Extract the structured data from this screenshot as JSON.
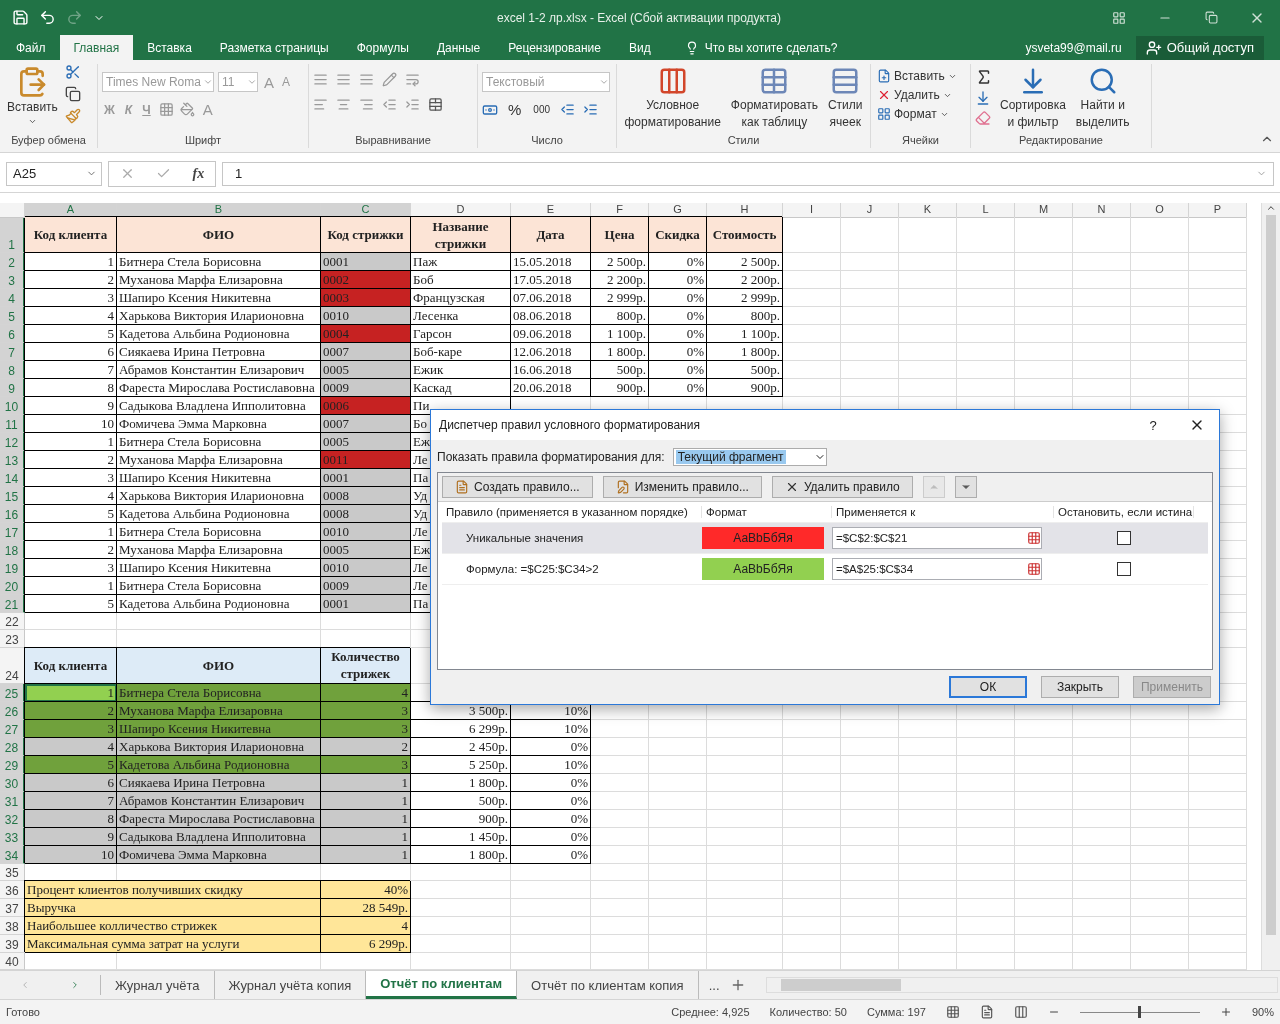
{
  "title_bar": {
    "title": "excel 1-2 лр.xlsx - Excel (Сбой активации продукта)"
  },
  "ribbon_tabs": [
    {
      "label": "Файл",
      "selected": false
    },
    {
      "label": "Главная",
      "selected": true
    },
    {
      "label": "Вставка",
      "selected": false
    },
    {
      "label": "Разметка страницы",
      "selected": false
    },
    {
      "label": "Формулы",
      "selected": false
    },
    {
      "label": "Данные",
      "selected": false
    },
    {
      "label": "Рецензирование",
      "selected": false
    },
    {
      "label": "Вид",
      "selected": false
    }
  ],
  "tell_me": "Что вы хотите сделать?",
  "account": {
    "user": "ysveta99@mail.ru",
    "share": "Общий доступ"
  },
  "ribbon": {
    "clipboard": {
      "paste": "Вставить",
      "label": "Буфер обмена"
    },
    "font": {
      "name": "Times New Roma",
      "size": "11",
      "grow": "A",
      "shrink": "A",
      "bold": "Ж",
      "italic": "К",
      "underline": "Ч",
      "font_color_button": "A",
      "label": "Шрифт"
    },
    "alignment": {
      "label": "Выравнивание"
    },
    "number": {
      "format": "Текстовый",
      "percent": "%",
      "thousands": "000",
      "label": "Число"
    },
    "styles": {
      "buttons": [
        [
          "Условное",
          "форматирование"
        ],
        [
          "Форматировать",
          "как таблицу"
        ],
        [
          "Стили",
          "ячеек"
        ]
      ],
      "label": "Стили"
    },
    "cells": {
      "buttons": [
        "Вставить",
        "Удалить",
        "Формат"
      ],
      "label": "Ячейки"
    },
    "editing": {
      "buttons": [
        [
          "Сортировка",
          "и фильтр"
        ],
        [
          "Найти и",
          "выделить"
        ]
      ],
      "label": "Редактирование"
    }
  },
  "formula_bar": {
    "name_box": "A25",
    "fx": "fx",
    "value": "1"
  },
  "columns": [
    {
      "label": "A",
      "selected": true
    },
    {
      "label": "B",
      "selected": true
    },
    {
      "label": "C",
      "selected": true
    },
    {
      "label": "D",
      "selected": false
    },
    {
      "label": "E",
      "selected": false
    },
    {
      "label": "F",
      "selected": false
    },
    {
      "label": "G",
      "selected": false
    },
    {
      "label": "H",
      "selected": false
    },
    {
      "label": "I",
      "selected": false
    },
    {
      "label": "J",
      "selected": false
    },
    {
      "label": "K",
      "selected": false
    },
    {
      "label": "L",
      "selected": false
    },
    {
      "label": "M",
      "selected": false
    },
    {
      "label": "N",
      "selected": false
    },
    {
      "label": "O",
      "selected": false
    },
    {
      "label": "P",
      "selected": false
    }
  ],
  "rows": [
    {
      "num": "1",
      "selected": true,
      "cells": [
        {
          "text": "Код клиента",
          "kind": "head"
        },
        {
          "text": "ФИО",
          "kind": "head"
        },
        {
          "text": "Код стрижки",
          "kind": "head"
        },
        {
          "text": "Название стрижки",
          "kind": "head"
        },
        {
          "text": "Дата",
          "kind": "head"
        },
        {
          "text": "Цена",
          "kind": "head"
        },
        {
          "text": "Скидка",
          "kind": "head"
        },
        {
          "text": "Стоимость",
          "kind": "head"
        }
      ]
    },
    {
      "num": "2",
      "selected": true,
      "cells": [
        {
          "text": "1",
          "kind": "num"
        },
        {
          "text": "Битнера Стела Борисовна",
          "kind": "text"
        },
        {
          "text": "0001",
          "kind": "code_unique"
        },
        {
          "text": "Паж",
          "kind": "text"
        },
        {
          "text": "15.05.2018",
          "kind": "text"
        },
        {
          "text": "2 500р.",
          "kind": "num"
        },
        {
          "text": "0%",
          "kind": "num"
        },
        {
          "text": "2 500р.",
          "kind": "num"
        }
      ]
    },
    {
      "num": "3",
      "selected": true,
      "cells": [
        {
          "text": "2",
          "kind": "num"
        },
        {
          "text": "Муханова Марфа Елизаровна",
          "kind": "text"
        },
        {
          "text": "0002",
          "kind": "code_dup"
        },
        {
          "text": "Боб",
          "kind": "text"
        },
        {
          "text": "17.05.2018",
          "kind": "text"
        },
        {
          "text": "2 200р.",
          "kind": "num"
        },
        {
          "text": "0%",
          "kind": "num"
        },
        {
          "text": "2 200р.",
          "kind": "num"
        }
      ]
    },
    {
      "num": "4",
      "selected": true,
      "cells": [
        {
          "text": "3",
          "kind": "num"
        },
        {
          "text": "Шапиро Ксения Никитевна",
          "kind": "text"
        },
        {
          "text": "0003",
          "kind": "code_dup"
        },
        {
          "text": "Французская",
          "kind": "text"
        },
        {
          "text": "07.06.2018",
          "kind": "text"
        },
        {
          "text": "2 999р.",
          "kind": "num"
        },
        {
          "text": "0%",
          "kind": "num"
        },
        {
          "text": "2 999р.",
          "kind": "num"
        }
      ]
    },
    {
      "num": "5",
      "selected": true,
      "cells": [
        {
          "text": "4",
          "kind": "num"
        },
        {
          "text": "Харькова Виктория Иларионовна",
          "kind": "text"
        },
        {
          "text": "0010",
          "kind": "code_unique"
        },
        {
          "text": "Лесенка",
          "kind": "text"
        },
        {
          "text": "08.06.2018",
          "kind": "text"
        },
        {
          "text": "800р.",
          "kind": "num"
        },
        {
          "text": "0%",
          "kind": "num"
        },
        {
          "text": "800р.",
          "kind": "num"
        }
      ]
    },
    {
      "num": "6",
      "selected": true,
      "cells": [
        {
          "text": "5",
          "kind": "num"
        },
        {
          "text": "Кадетова Альбина Родионовна",
          "kind": "text"
        },
        {
          "text": "0004",
          "kind": "code_dup"
        },
        {
          "text": "Гарсон",
          "kind": "text"
        },
        {
          "text": "09.06.2018",
          "kind": "text"
        },
        {
          "text": "1 100р.",
          "kind": "num"
        },
        {
          "text": "0%",
          "kind": "num"
        },
        {
          "text": "1 100р.",
          "kind": "num"
        }
      ]
    },
    {
      "num": "7",
      "selected": true,
      "cells": [
        {
          "text": "6",
          "kind": "num"
        },
        {
          "text": "Сиякаева Ирина Петровна",
          "kind": "text"
        },
        {
          "text": "0007",
          "kind": "code_unique"
        },
        {
          "text": "Боб-каре",
          "kind": "text"
        },
        {
          "text": "12.06.2018",
          "kind": "text"
        },
        {
          "text": "1 800р.",
          "kind": "num"
        },
        {
          "text": "0%",
          "kind": "num"
        },
        {
          "text": "1 800р.",
          "kind": "num"
        }
      ]
    },
    {
      "num": "8",
      "selected": true,
      "cells": [
        {
          "text": "7",
          "kind": "num"
        },
        {
          "text": "Абрамов Константин Елизарович",
          "kind": "text"
        },
        {
          "text": "0005",
          "kind": "code_unique"
        },
        {
          "text": "Ежик",
          "kind": "text"
        },
        {
          "text": "16.06.2018",
          "kind": "text"
        },
        {
          "text": "500р.",
          "kind": "num"
        },
        {
          "text": "0%",
          "kind": "num"
        },
        {
          "text": "500р.",
          "kind": "num"
        }
      ]
    },
    {
      "num": "9",
      "selected": true,
      "cells": [
        {
          "text": "8",
          "kind": "num"
        },
        {
          "text": "Фареста Мирослава Ростиславовна",
          "kind": "text"
        },
        {
          "text": "0009",
          "kind": "code_unique"
        },
        {
          "text": "Каскад",
          "kind": "text"
        },
        {
          "text": "20.06.2018",
          "kind": "text"
        },
        {
          "text": "900р.",
          "kind": "num"
        },
        {
          "text": "0%",
          "kind": "num"
        },
        {
          "text": "900р.",
          "kind": "num"
        }
      ]
    },
    {
      "num": "10",
      "selected": true,
      "cells": [
        {
          "text": "9",
          "kind": "num"
        },
        {
          "text": "Садыкова Владлена Ипполитовна",
          "kind": "text"
        },
        {
          "text": "0006",
          "kind": "code_dup"
        },
        {
          "text": "Пи",
          "kind": "text"
        }
      ]
    },
    {
      "num": "11",
      "selected": true,
      "cells": [
        {
          "text": "10",
          "kind": "num"
        },
        {
          "text": "Фомичева Эмма Марковна",
          "kind": "text"
        },
        {
          "text": "0007",
          "kind": "code_unique"
        },
        {
          "text": "Бо",
          "kind": "text"
        }
      ]
    },
    {
      "num": "12",
      "selected": true,
      "cells": [
        {
          "text": "1",
          "kind": "num"
        },
        {
          "text": "Битнера Стела Борисовна",
          "kind": "text"
        },
        {
          "text": "0005",
          "kind": "code_unique"
        },
        {
          "text": "Еж",
          "kind": "text"
        }
      ]
    },
    {
      "num": "13",
      "selected": true,
      "cells": [
        {
          "text": "2",
          "kind": "num"
        },
        {
          "text": "Муханова Марфа Елизаровна",
          "kind": "text"
        },
        {
          "text": "0011",
          "kind": "code_dup"
        },
        {
          "text": "Ле",
          "kind": "text"
        }
      ]
    },
    {
      "num": "14",
      "selected": true,
      "cells": [
        {
          "text": "3",
          "kind": "num"
        },
        {
          "text": "Шапиро Ксения Никитевна",
          "kind": "text"
        },
        {
          "text": "0001",
          "kind": "code_unique"
        },
        {
          "text": "Па",
          "kind": "text"
        }
      ]
    },
    {
      "num": "15",
      "selected": true,
      "cells": [
        {
          "text": "4",
          "kind": "num"
        },
        {
          "text": "Харькова Виктория Иларионовна",
          "kind": "text"
        },
        {
          "text": "0008",
          "kind": "code_unique"
        },
        {
          "text": "Уд",
          "kind": "text"
        }
      ]
    },
    {
      "num": "16",
      "selected": true,
      "cells": [
        {
          "text": "5",
          "kind": "num"
        },
        {
          "text": "Кадетова Альбина Родионовна",
          "kind": "text"
        },
        {
          "text": "0008",
          "kind": "code_unique"
        },
        {
          "text": "Уд",
          "kind": "text"
        }
      ]
    },
    {
      "num": "17",
      "selected": true,
      "cells": [
        {
          "text": "1",
          "kind": "num"
        },
        {
          "text": "Битнера Стела Борисовна",
          "kind": "text"
        },
        {
          "text": "0010",
          "kind": "code_unique"
        },
        {
          "text": "Ле",
          "kind": "text"
        }
      ]
    },
    {
      "num": "18",
      "selected": true,
      "cells": [
        {
          "text": "2",
          "kind": "num"
        },
        {
          "text": "Муханова Марфа Елизаровна",
          "kind": "text"
        },
        {
          "text": "0005",
          "kind": "code_unique"
        },
        {
          "text": "Еж",
          "kind": "text"
        }
      ]
    },
    {
      "num": "19",
      "selected": true,
      "cells": [
        {
          "text": "3",
          "kind": "num"
        },
        {
          "text": "Шапиро Ксения Никитевна",
          "kind": "text"
        },
        {
          "text": "0010",
          "kind": "code_unique"
        },
        {
          "text": "Ле",
          "kind": "text"
        }
      ]
    },
    {
      "num": "20",
      "selected": true,
      "cells": [
        {
          "text": "1",
          "kind": "num"
        },
        {
          "text": "Битнера Стела Борисовна",
          "kind": "text"
        },
        {
          "text": "0009",
          "kind": "code_unique"
        },
        {
          "text": "Ле",
          "kind": "text"
        }
      ]
    },
    {
      "num": "21",
      "selected": true,
      "cells": [
        {
          "text": "5",
          "kind": "num"
        },
        {
          "text": "Кадетова Альбина Родионовна",
          "kind": "text"
        },
        {
          "text": "0001",
          "kind": "code_unique"
        },
        {
          "text": "Па",
          "kind": "text"
        }
      ]
    },
    {
      "num": "22",
      "selected": false,
      "cells": []
    },
    {
      "num": "23",
      "selected": false,
      "cells": []
    },
    {
      "num": "24",
      "selected": false,
      "cells": [
        {
          "text": "Код клиента",
          "kind": "head_blue"
        },
        {
          "text": "ФИО",
          "kind": "head_blue"
        },
        {
          "text": "Количество стрижек",
          "kind": "head_blue"
        }
      ]
    },
    {
      "num": "25",
      "selected": true,
      "cells": [
        {
          "text": "1",
          "kind": "active_num"
        },
        {
          "text": "Битнера Стела Борисовна",
          "kind": "green_text"
        },
        {
          "text": "4",
          "kind": "green_num"
        }
      ]
    },
    {
      "num": "26",
      "selected": true,
      "cells": [
        {
          "text": "2",
          "kind": "green_num"
        },
        {
          "text": "Муханова Марфа Елизаровна",
          "kind": "green_text"
        },
        {
          "text": "3",
          "kind": "green_num"
        },
        {
          "text": "3 500р.",
          "kind": "num"
        },
        {
          "text": "10%",
          "kind": "num"
        }
      ]
    },
    {
      "num": "27",
      "selected": true,
      "cells": [
        {
          "text": "3",
          "kind": "green_num"
        },
        {
          "text": "Шапиро Ксения Никитевна",
          "kind": "green_text"
        },
        {
          "text": "3",
          "kind": "green_num"
        },
        {
          "text": "6 299р.",
          "kind": "num"
        },
        {
          "text": "10%",
          "kind": "num"
        }
      ]
    },
    {
      "num": "28",
      "selected": true,
      "cells": [
        {
          "text": "4",
          "kind": "grey_num"
        },
        {
          "text": "Харькова Виктория Иларионовна",
          "kind": "grey_text"
        },
        {
          "text": "2",
          "kind": "grey_num"
        },
        {
          "text": "2 450р.",
          "kind": "num"
        },
        {
          "text": "0%",
          "kind": "num"
        }
      ]
    },
    {
      "num": "29",
      "selected": true,
      "cells": [
        {
          "text": "5",
          "kind": "green_num"
        },
        {
          "text": "Кадетова Альбина Родионовна",
          "kind": "green_text"
        },
        {
          "text": "3",
          "kind": "green_num"
        },
        {
          "text": "5 250р.",
          "kind": "num"
        },
        {
          "text": "10%",
          "kind": "num"
        }
      ]
    },
    {
      "num": "30",
      "selected": true,
      "cells": [
        {
          "text": "6",
          "kind": "grey_num"
        },
        {
          "text": "Сиякаева Ирина Петровна",
          "kind": "grey_text"
        },
        {
          "text": "1",
          "kind": "grey_num"
        },
        {
          "text": "1 800р.",
          "kind": "num"
        },
        {
          "text": "0%",
          "kind": "num"
        }
      ]
    },
    {
      "num": "31",
      "selected": true,
      "cells": [
        {
          "text": "7",
          "kind": "grey_num"
        },
        {
          "text": "Абрамов Константин Елизарович",
          "kind": "grey_text"
        },
        {
          "text": "1",
          "kind": "grey_num"
        },
        {
          "text": "500р.",
          "kind": "num"
        },
        {
          "text": "0%",
          "kind": "num"
        }
      ]
    },
    {
      "num": "32",
      "selected": true,
      "cells": [
        {
          "text": "8",
          "kind": "grey_num"
        },
        {
          "text": "Фареста Мирослава Ростиславовна",
          "kind": "grey_text"
        },
        {
          "text": "1",
          "kind": "grey_num"
        },
        {
          "text": "900р.",
          "kind": "num"
        },
        {
          "text": "0%",
          "kind": "num"
        }
      ]
    },
    {
      "num": "33",
      "selected": true,
      "cells": [
        {
          "text": "9",
          "kind": "grey_num"
        },
        {
          "text": "Садыкова Владлена Ипполитовна",
          "kind": "grey_text"
        },
        {
          "text": "1",
          "kind": "grey_num"
        },
        {
          "text": "1 450р.",
          "kind": "num"
        },
        {
          "text": "0%",
          "kind": "num"
        }
      ]
    },
    {
      "num": "34",
      "selected": true,
      "cells": [
        {
          "text": "10",
          "kind": "grey_num"
        },
        {
          "text": "Фомичева Эмма Марковна",
          "kind": "grey_text"
        },
        {
          "text": "1",
          "kind": "grey_num"
        },
        {
          "text": "1 800р.",
          "kind": "num"
        },
        {
          "text": "0%",
          "kind": "num"
        }
      ]
    },
    {
      "num": "35",
      "selected": false,
      "cells": []
    },
    {
      "num": "36",
      "selected": false,
      "cells": [
        {
          "text": "Процент клиентов получивших скидку",
          "kind": "sum_text"
        },
        {
          "text": "40%",
          "kind": "sum_num"
        }
      ]
    },
    {
      "num": "37",
      "selected": false,
      "cells": [
        {
          "text": "Выручка",
          "kind": "sum_text"
        },
        {
          "text": "28 549р.",
          "kind": "sum_num"
        }
      ]
    },
    {
      "num": "38",
      "selected": false,
      "cells": [
        {
          "text": "Наибольшее колличество стрижек",
          "kind": "sum_text"
        },
        {
          "text": "4",
          "kind": "sum_num"
        }
      ]
    },
    {
      "num": "39",
      "selected": false,
      "cells": [
        {
          "text": "Максимальная сумма затрат на услуги",
          "kind": "sum_text"
        },
        {
          "text": "6 299р.",
          "kind": "sum_num"
        }
      ]
    },
    {
      "num": "40",
      "selected": false,
      "cells": []
    }
  ],
  "dialog": {
    "title": "Диспетчер правил условного форматирования",
    "help": "?",
    "show_for": {
      "label": "Показать правила форматирования для:",
      "value": "Текущий фрагмент"
    },
    "toolbar": [
      {
        "label": "Создать правило...",
        "kind": "new"
      },
      {
        "label": "Изменить правило...",
        "kind": "edit"
      },
      {
        "label": "Удалить правило",
        "kind": "delete"
      }
    ],
    "move_up": {
      "disabled": true
    },
    "move_down": {
      "disabled": false
    },
    "columns": [
      "Правило (применяется в указанном порядке)",
      "Формат",
      "Применяется к",
      "Остановить, если истина"
    ],
    "rules": [
      {
        "rule": "Уникальные значения",
        "format": "АаBbБбЯя",
        "color": "#ff2929",
        "applies_to": "=$C$2:$C$21",
        "stop": false,
        "selected": true
      },
      {
        "rule": "Формула: =$C25:$C34>2",
        "format": "АаBbБбЯя",
        "color": "#92d050",
        "applies_to": "=$A$25:$C$34",
        "stop": false,
        "selected": false
      }
    ],
    "buttons": [
      {
        "label": "ОК",
        "default": true,
        "disabled": false
      },
      {
        "label": "Закрыть",
        "default": false,
        "disabled": false
      },
      {
        "label": "Применить",
        "default": false,
        "disabled": true
      }
    ]
  },
  "sheet_tabs": [
    {
      "label": "Журнал учёта",
      "selected": false
    },
    {
      "label": "Журнал учёта копия",
      "selected": false
    },
    {
      "label": "Отчёт по клиентам",
      "selected": true
    },
    {
      "label": "Отчёт по клиентам копия",
      "selected": false
    }
  ],
  "more_tabs": "...",
  "status_bar": {
    "state": "Готово",
    "average": "Среднее: 4,925",
    "count": "Количество: 50",
    "sum": "Сумма: 197",
    "zoom": {
      "label": "90%",
      "level": 0.5
    }
  }
}
